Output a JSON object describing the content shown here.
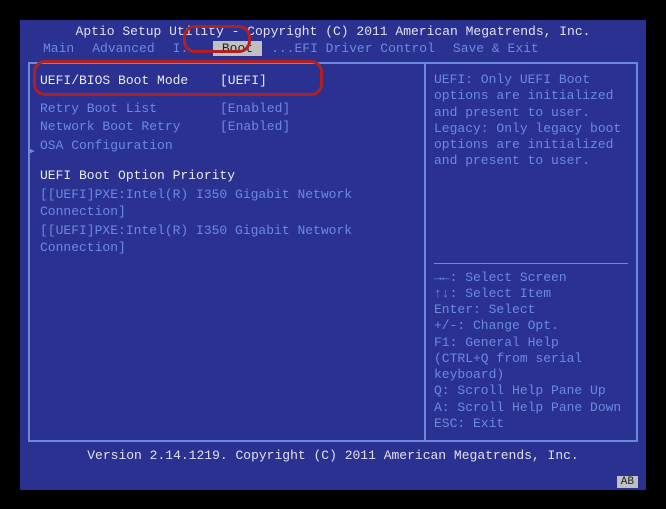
{
  "header": {
    "title": "Aptio Setup Utility - Copyright (C) 2011 American Megatrends, Inc."
  },
  "menu": {
    "items": [
      "Main",
      "Advanced",
      "I...",
      "Boot",
      "...EFI Driver Control",
      "Save & Exit"
    ],
    "active_index": 3
  },
  "boot": {
    "mode_label": "UEFI/BIOS Boot Mode",
    "mode_value": "[UEFI]",
    "retry_label": "Retry Boot List",
    "retry_value": "[Enabled]",
    "netretry_label": "Network Boot Retry",
    "netretry_value": "[Enabled]",
    "osa_label": "OSA Configuration",
    "priority_heading": "UEFI Boot Option Priority",
    "entries": [
      "[[UEFI]PXE:Intel(R) I350 Gigabit Network Connection]",
      "[[UEFI]PXE:Intel(R) I350 Gigabit Network Connection]"
    ]
  },
  "help": {
    "text": "UEFI: Only UEFI Boot options are initialized and present to user. Legacy: Only legacy boot options are initialized and present to user."
  },
  "keys": {
    "k1": "→←: Select Screen",
    "k2": "↑↓: Select Item",
    "k3": "Enter: Select",
    "k4": "+/-: Change Opt.",
    "k5": "F1: General Help",
    "k6": " (CTRL+Q from serial keyboard)",
    "k7": "Q: Scroll Help Pane Up",
    "k8": "A: Scroll Help Pane Down",
    "k9": "ESC: Exit"
  },
  "footer": {
    "text": "Version 2.14.1219. Copyright (C) 2011 American Megatrends, Inc."
  },
  "badge": "AB"
}
